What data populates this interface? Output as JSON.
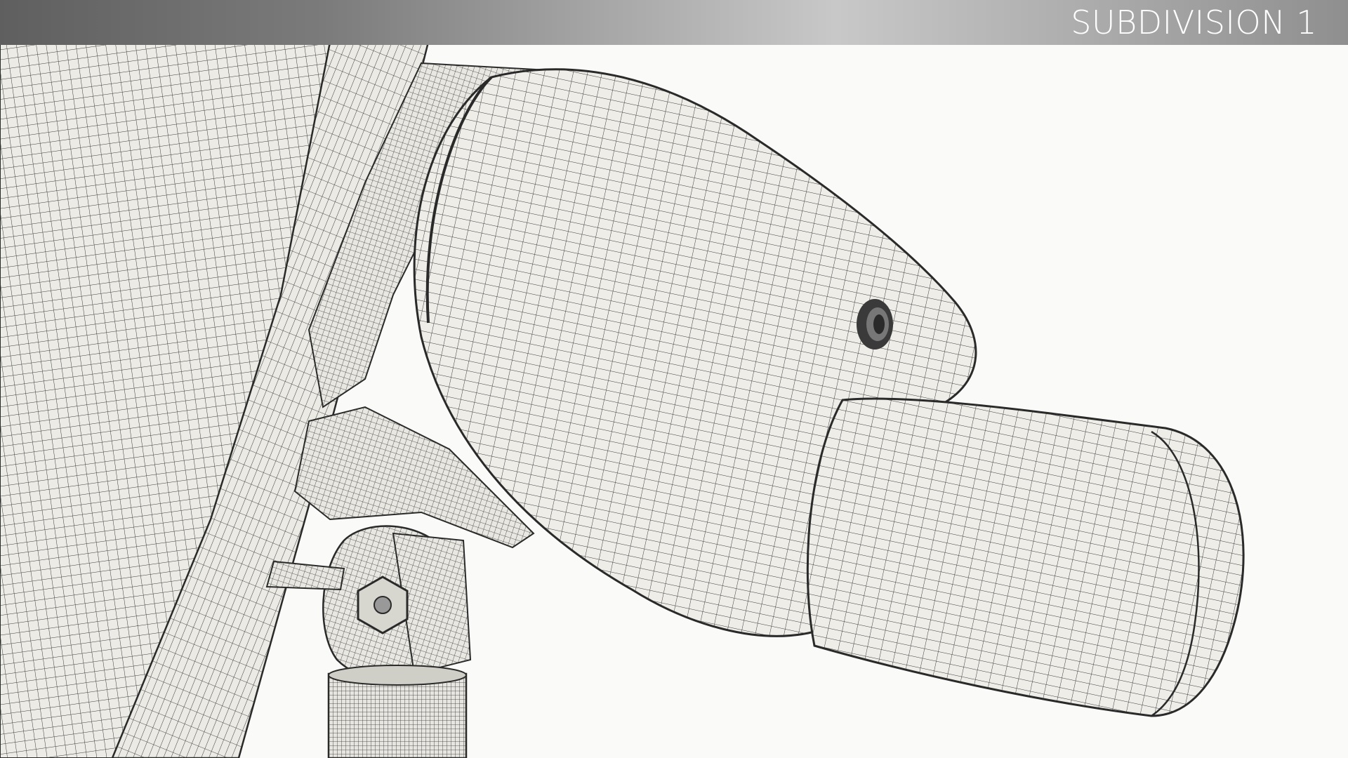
{
  "header": {
    "title": "SUBDIVISION 1"
  },
  "scene": {
    "subject": "wireframe-mesh-render",
    "colors": {
      "background": "#fafaf8",
      "surface": "#ecebe5",
      "wire": "#2f2f2f",
      "banner_dark": "#5f5f5f",
      "banner_light": "#c8c8c8"
    }
  }
}
